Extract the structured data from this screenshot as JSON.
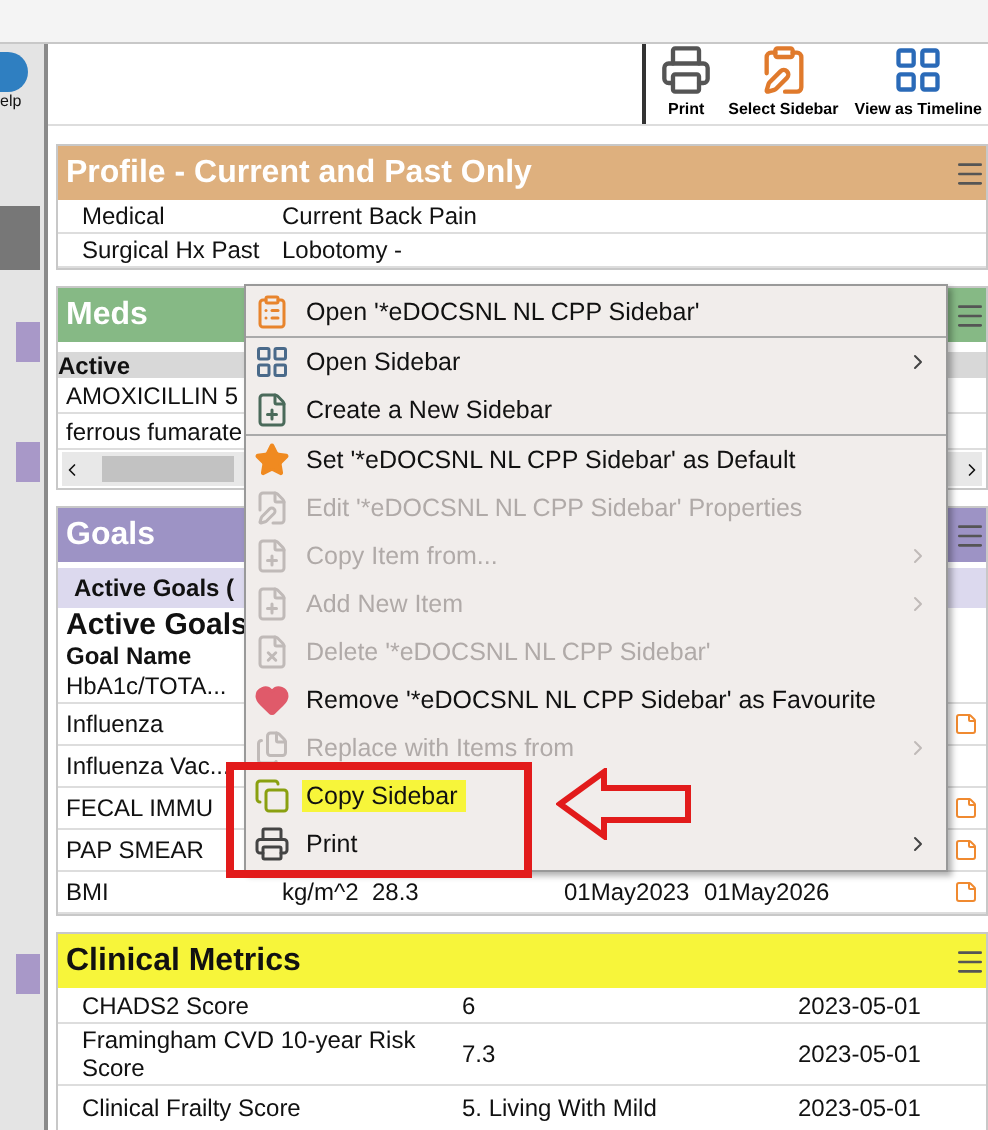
{
  "left_rail": {
    "help_label": "elp"
  },
  "toolbar": {
    "buttons": [
      {
        "label": "Print"
      },
      {
        "label": "Select Sidebar"
      },
      {
        "label": "View as Timeline"
      }
    ]
  },
  "profile": {
    "title": "Profile - Current and Past Only",
    "color": "#deb07e",
    "rows": [
      {
        "category": "Medical",
        "item": "Current Back Pain"
      },
      {
        "category": "Surgical Hx Past",
        "item": "Lobotomy -"
      }
    ]
  },
  "meds": {
    "title": "Meds",
    "color": "#86b985",
    "column_header": "Active",
    "rows": [
      "AMOXICILLIN 5",
      "ferrous fumarate"
    ]
  },
  "goals": {
    "title": "Goals",
    "color": "#9d93c5",
    "tab": "Active Goals (",
    "heading": "Active Goals",
    "column_header": "Goal Name",
    "rows": [
      {
        "name": "HbA1c/TOTA...",
        "note": false
      },
      {
        "name": "Influenza",
        "note": true
      },
      {
        "name": "Influenza Vac...",
        "note": false
      },
      {
        "name": "FECAL IMMU",
        "note": true
      },
      {
        "name": "PAP SMEAR",
        "note": true
      },
      {
        "name": "BMI",
        "unit": "kg/m^2",
        "value": "28.3",
        "date": "01May2023",
        "due": "01May2026",
        "note": true
      }
    ]
  },
  "clinical_metrics": {
    "title": "Clinical Metrics",
    "color": "#f7f53a",
    "rows": [
      {
        "name": "CHADS2 Score",
        "value": "6",
        "date": "2023-05-01"
      },
      {
        "name": "Framingham CVD 10-year Risk Score",
        "value": "7.3",
        "date": "2023-05-01"
      },
      {
        "name": "Clinical Frailty Score",
        "value": "5. Living With Mild",
        "date": "2023-05-01"
      }
    ]
  },
  "context_menu": {
    "items": [
      {
        "label": "Open '*eDOCSNL NL CPP Sidebar'",
        "disabled": false,
        "submenu": false,
        "separator_after": true,
        "highlighted": false
      },
      {
        "label": "Open Sidebar",
        "disabled": false,
        "submenu": true,
        "separator_after": false,
        "highlighted": false
      },
      {
        "label": "Create a New Sidebar",
        "disabled": false,
        "submenu": false,
        "separator_after": true,
        "highlighted": false
      },
      {
        "label": "Set '*eDOCSNL NL CPP Sidebar' as Default",
        "disabled": false,
        "submenu": false,
        "separator_after": false,
        "highlighted": false
      },
      {
        "label": "Edit '*eDOCSNL NL CPP Sidebar' Properties",
        "disabled": true,
        "submenu": false,
        "separator_after": false,
        "highlighted": false
      },
      {
        "label": "Copy Item from...",
        "disabled": true,
        "submenu": true,
        "separator_after": false,
        "highlighted": false
      },
      {
        "label": "Add New Item",
        "disabled": true,
        "submenu": true,
        "separator_after": false,
        "highlighted": false
      },
      {
        "label": "Delete '*eDOCSNL NL CPP Sidebar'",
        "disabled": true,
        "submenu": false,
        "separator_after": false,
        "highlighted": false
      },
      {
        "label": "Remove '*eDOCSNL NL CPP Sidebar' as Favourite",
        "disabled": false,
        "submenu": false,
        "separator_after": false,
        "highlighted": false
      },
      {
        "label": "Replace with Items from",
        "disabled": true,
        "submenu": true,
        "separator_after": false,
        "highlighted": false
      },
      {
        "label": "Copy Sidebar",
        "disabled": false,
        "submenu": false,
        "separator_after": false,
        "highlighted": true
      },
      {
        "label": "Print",
        "disabled": false,
        "submenu": true,
        "separator_after": false,
        "highlighted": false
      }
    ]
  }
}
